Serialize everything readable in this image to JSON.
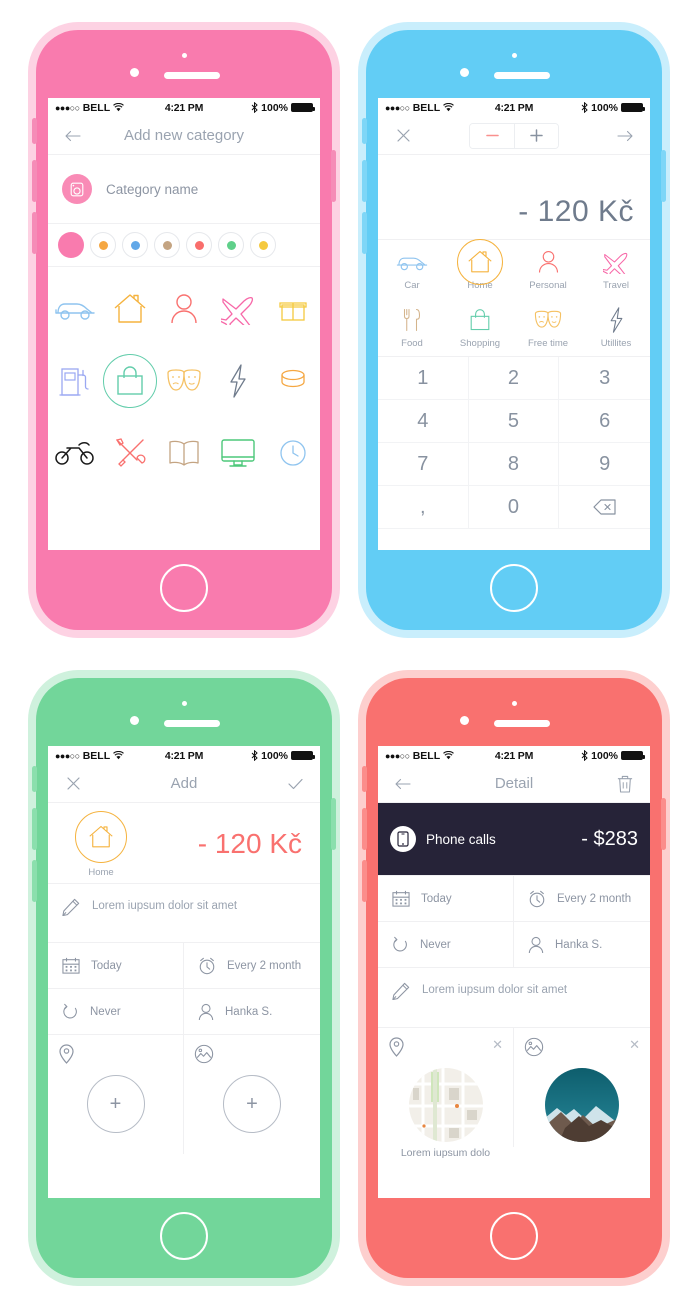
{
  "statusbar": {
    "carrier": "BELL",
    "dots": "●●●○○",
    "wifi": "wifi-icon",
    "time": "4:21 PM",
    "bluetooth": "bluetooth-icon",
    "battery": "100%"
  },
  "phones": {
    "pink": {
      "frame_color": "#f97bae",
      "navbar": {
        "back": "←",
        "title": "Add new category"
      },
      "category_name_placeholder": "Category name",
      "swatches": [
        {
          "color": "#f97bae",
          "selected": true
        },
        {
          "color": "#f5a742",
          "selected": false
        },
        {
          "color": "#62a8e8",
          "selected": false
        },
        {
          "color": "#c4a482",
          "selected": false
        },
        {
          "color": "#f96e6c",
          "selected": false
        },
        {
          "color": "#5fd08a",
          "selected": false
        },
        {
          "color": "#f5c93f",
          "selected": false
        }
      ],
      "icons": [
        {
          "name": "car-icon",
          "color": "#8fc4ef",
          "selected": false
        },
        {
          "name": "home-icon",
          "color": "#f5b33f",
          "selected": false
        },
        {
          "name": "person-icon",
          "color": "#f9716f",
          "selected": false
        },
        {
          "name": "plane-icon",
          "color": "#f768a8",
          "selected": false
        },
        {
          "name": "gift-icon",
          "color": "#f5c93f",
          "selected": false
        },
        {
          "name": "fuel-icon",
          "color": "#9aa8f2",
          "selected": false
        },
        {
          "name": "shopping-bag-icon",
          "color": "#63cdab",
          "selected": true
        },
        {
          "name": "masks-icon",
          "color": "#f5c163",
          "selected": false
        },
        {
          "name": "bolt-icon",
          "color": "#6f7b8c",
          "selected": false
        },
        {
          "name": "coins-icon",
          "color": "#f5a742",
          "selected": false
        },
        {
          "name": "motorbike-icon",
          "color": "#1b1b1b",
          "selected": false
        },
        {
          "name": "tools-icon",
          "color": "#f9716f",
          "selected": false
        },
        {
          "name": "book-icon",
          "color": "#c4a482",
          "selected": false
        },
        {
          "name": "monitor-icon",
          "color": "#4dc87a",
          "selected": false
        },
        {
          "name": "clock-icon",
          "color": "#8fc4ef",
          "selected": false
        }
      ]
    },
    "blue": {
      "frame_color": "#62cdf5",
      "toolbar": {
        "close": "✕",
        "minus": "−",
        "plus": "+",
        "next": "→"
      },
      "amount": "- 120 Kč",
      "categories": [
        {
          "label": "Car",
          "icon": "car-icon",
          "color": "#8fc4ef",
          "selected": false
        },
        {
          "label": "Home",
          "icon": "home-icon",
          "color": "#f5b33f",
          "selected": true
        },
        {
          "label": "Personal",
          "icon": "person-icon",
          "color": "#f9716f",
          "selected": false
        },
        {
          "label": "Travel",
          "icon": "plane-icon",
          "color": "#f768a8",
          "selected": false
        },
        {
          "label": "Food",
          "icon": "cutlery-icon",
          "color": "#d4b48c",
          "selected": false
        },
        {
          "label": "Shopping",
          "icon": "shopping-bag-icon",
          "color": "#63cdab",
          "selected": false
        },
        {
          "label": "Free time",
          "icon": "masks-icon",
          "color": "#f5c163",
          "selected": false
        },
        {
          "label": "Utillites",
          "icon": "bolt-icon",
          "color": "#6f7b8c",
          "selected": false
        }
      ],
      "keypad": [
        "1",
        "2",
        "3",
        "4",
        "5",
        "6",
        "7",
        "8",
        "9",
        ",",
        "0",
        "backspace-icon"
      ]
    },
    "green": {
      "frame_color": "#72d69a",
      "navbar": {
        "close": "✕",
        "title": "Add",
        "confirm": "✓"
      },
      "category": {
        "label": "Home",
        "icon": "home-icon",
        "color": "#f5b33f"
      },
      "amount": "- 120 Kč",
      "amount_color": "#f9716f",
      "note_placeholder": "Lorem iupsum dolor sit amet",
      "meta": [
        {
          "icon": "calendar-icon",
          "label": "Today"
        },
        {
          "icon": "alarm-icon",
          "label": "Every 2 month"
        },
        {
          "icon": "repeat-icon",
          "label": "Never"
        },
        {
          "icon": "person-icon",
          "label": "Hanka S."
        }
      ],
      "attachments": [
        {
          "icon": "pin-icon",
          "action": "+"
        },
        {
          "icon": "photo-icon",
          "action": "+"
        }
      ]
    },
    "red": {
      "frame_color": "#f9716f",
      "navbar": {
        "back": "←",
        "title": "Detail",
        "delete": "trash-icon"
      },
      "card": {
        "icon": "phone-icon",
        "name": "Phone calls",
        "amount": "- $283",
        "background": "#262338"
      },
      "meta": [
        {
          "icon": "calendar-icon",
          "label": "Today"
        },
        {
          "icon": "alarm-icon",
          "label": "Every 2 month"
        },
        {
          "icon": "repeat-icon",
          "label": "Never"
        },
        {
          "icon": "person-icon",
          "label": "Hanka S."
        }
      ],
      "note": "Lorem iupsum dolor sit amet",
      "attachments": [
        {
          "icon": "pin-icon",
          "close": "✕",
          "caption": "Lorem iupsum dolo",
          "thumb": "map-thumbnail"
        },
        {
          "icon": "photo-icon",
          "close": "✕",
          "caption": "",
          "thumb": "mountain-photo"
        }
      ]
    }
  }
}
